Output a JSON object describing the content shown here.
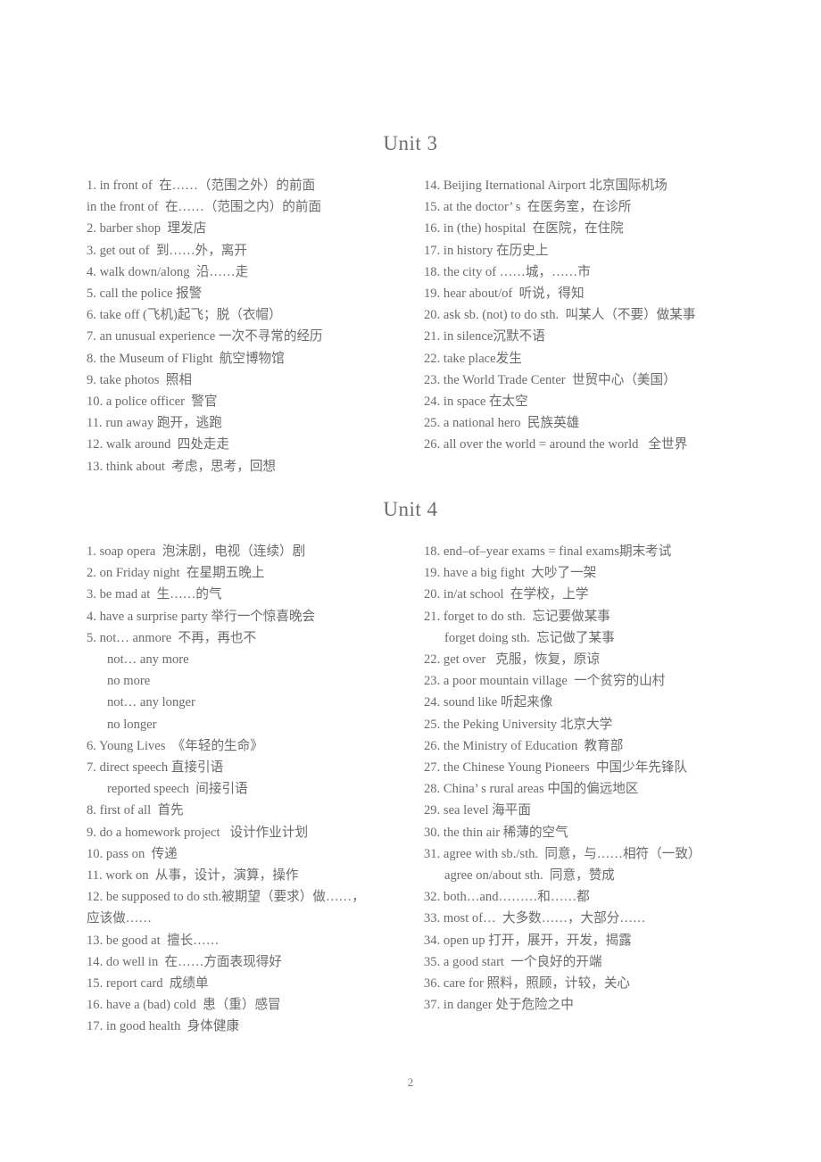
{
  "document": {
    "page_number": "2",
    "text_color": "#6a6a6a",
    "background_color": "#ffffff"
  },
  "units": [
    {
      "heading": "Unit 3",
      "left_column": [
        {
          "type": "item",
          "text": "1. in front of  在……（范围之外）的前面"
        },
        {
          "type": "cont",
          "text": "in the front of  在……（范围之内）的前面"
        },
        {
          "type": "item",
          "text": "2. barber shop  理发店"
        },
        {
          "type": "item",
          "text": "3. get out of  到……外，离开"
        },
        {
          "type": "item",
          "text": "4. walk down/along  沿……走"
        },
        {
          "type": "item",
          "text": "5. call the police 报警"
        },
        {
          "type": "item",
          "text": "6. take off (飞机)起飞；脱（衣帽）"
        },
        {
          "type": "item",
          "text": "7. an unusual experience 一次不寻常的经历"
        },
        {
          "type": "item",
          "text": "8. the Museum of Flight  航空博物馆"
        },
        {
          "type": "item",
          "text": "9. take photos  照相"
        },
        {
          "type": "item",
          "text": "10. a police officer  警官"
        },
        {
          "type": "item",
          "text": "11. run away 跑开，逃跑"
        },
        {
          "type": "item",
          "text": "12. walk around  四处走走"
        },
        {
          "type": "item",
          "text": "13. think about  考虑，思考，回想"
        }
      ],
      "right_column": [
        {
          "type": "item",
          "text": "14. Beijing Iternational Airport 北京国际机场"
        },
        {
          "type": "item",
          "text": "15. at the doctor’ s  在医务室，在诊所"
        },
        {
          "type": "item",
          "text": "16. in (the) hospital  在医院，在住院"
        },
        {
          "type": "item",
          "text": "17. in history 在历史上"
        },
        {
          "type": "item",
          "text": "18. the city of ……城，……市"
        },
        {
          "type": "item",
          "text": "19. hear about/of  听说，得知"
        },
        {
          "type": "item",
          "text": "20. ask sb. (not) to do sth.  叫某人（不要）做某事"
        },
        {
          "type": "item",
          "text": "21. in silence沉默不语"
        },
        {
          "type": "item",
          "text": "22. take place发生"
        },
        {
          "type": "item",
          "text": "23. the World Trade Center  世贸中心（美国）"
        },
        {
          "type": "item",
          "text": "24. in space 在太空"
        },
        {
          "type": "item",
          "text": "25. a national hero  民族英雄"
        },
        {
          "type": "item",
          "text": "26. all over the world = around the world   全世界"
        }
      ]
    },
    {
      "heading": "Unit 4",
      "left_column": [
        {
          "type": "item",
          "text": "1. soap opera  泡沫剧，电视（连续）剧"
        },
        {
          "type": "item",
          "text": "2. on Friday night  在星期五晚上"
        },
        {
          "type": "item",
          "text": "3. be mad at  生……的气"
        },
        {
          "type": "item",
          "text": "4. have a surprise party 举行一个惊喜晚会"
        },
        {
          "type": "item",
          "text": "5. not… anmore  不再，再也不"
        },
        {
          "type": "sub",
          "text": "not… any more"
        },
        {
          "type": "sub",
          "text": "no more"
        },
        {
          "type": "sub",
          "text": "not… any longer"
        },
        {
          "type": "sub",
          "text": "no longer"
        },
        {
          "type": "item",
          "text": "6. Young Lives  《年轻的生命》"
        },
        {
          "type": "item",
          "text": "7. direct speech 直接引语"
        },
        {
          "type": "sub",
          "text": "reported speech  间接引语"
        },
        {
          "type": "item",
          "text": "8. first of all  首先"
        },
        {
          "type": "item",
          "text": "9. do a homework project   设计作业计划"
        },
        {
          "type": "item",
          "text": "10. pass on  传递"
        },
        {
          "type": "item",
          "text": "11. work on  从事，设计，演算，操作"
        },
        {
          "type": "item",
          "text": "12. be supposed to do sth.被期望（要求）做……，"
        },
        {
          "type": "cont",
          "text": "应该做……"
        },
        {
          "type": "item",
          "text": "13. be good at  擅长……"
        },
        {
          "type": "item",
          "text": "14. do well in  在……方面表现得好"
        },
        {
          "type": "item",
          "text": "15. report card  成绩单"
        },
        {
          "type": "item",
          "text": "16. have a (bad) cold  患（重）感冒"
        },
        {
          "type": "item",
          "text": "17. in good health  身体健康"
        }
      ],
      "right_column": [
        {
          "type": "item",
          "text": "18. end–of–year exams = final exams期末考试"
        },
        {
          "type": "item",
          "text": "19. have a big fight  大吵了一架"
        },
        {
          "type": "item",
          "text": "20. in/at school  在学校，上学"
        },
        {
          "type": "item",
          "text": "21. forget to do sth.  忘记要做某事"
        },
        {
          "type": "sub",
          "text": "forget doing sth.  忘记做了某事"
        },
        {
          "type": "item",
          "text": "22. get over   克服，恢复，原谅"
        },
        {
          "type": "item",
          "text": "23. a poor mountain village  一个贫穷的山村"
        },
        {
          "type": "item",
          "text": "24. sound like 听起来像"
        },
        {
          "type": "item",
          "text": "25. the Peking University 北京大学"
        },
        {
          "type": "item",
          "text": "26. the Ministry of Education  教育部"
        },
        {
          "type": "item",
          "text": "27. the Chinese Young Pioneers  中国少年先锋队"
        },
        {
          "type": "item",
          "text": "28. China’ s rural areas 中国的偏远地区"
        },
        {
          "type": "item",
          "text": "29. sea level 海平面"
        },
        {
          "type": "item",
          "text": "30. the thin air 稀薄的空气"
        },
        {
          "type": "item",
          "text": "31. agree with sb./sth.  同意，与……相符（一致）"
        },
        {
          "type": "sub",
          "text": "agree on/about sth.  同意，赞成"
        },
        {
          "type": "item",
          "text": "32. both…and………和……都"
        },
        {
          "type": "item",
          "text": "33. most of…  大多数……，大部分……"
        },
        {
          "type": "item",
          "text": "34. open up 打开，展开，开发，揭露"
        },
        {
          "type": "item",
          "text": "35. a good start  一个良好的开端"
        },
        {
          "type": "item",
          "text": "36. care for 照料，照顾，计较，关心"
        },
        {
          "type": "item",
          "text": "37. in danger 处于危险之中"
        }
      ]
    }
  ]
}
